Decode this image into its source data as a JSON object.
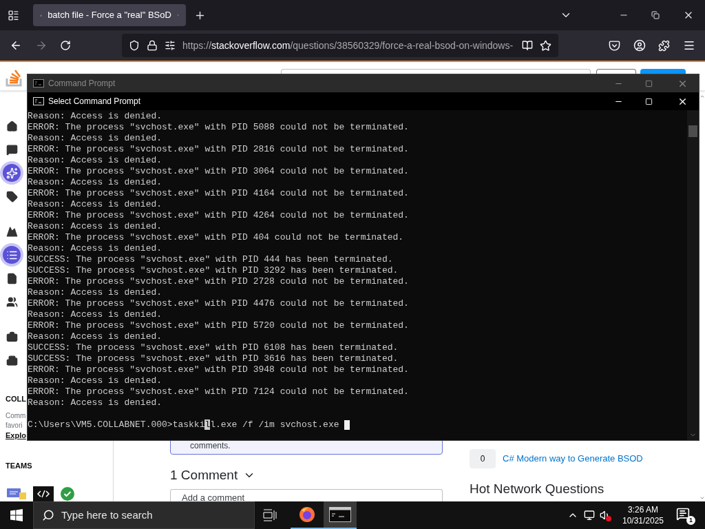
{
  "browser": {
    "tab": {
      "title": "batch file - Force a \"real\" BSoD",
      "selected": true
    },
    "url": {
      "scheme": "https://",
      "host": "stackoverflow.com",
      "path": "/questions/38560329/force-a-real-bsod-on-windows-"
    }
  },
  "page": {
    "sidebar": {
      "sections": [
        [
          {
            "kind": "home",
            "circled": false
          },
          {
            "kind": "question",
            "circled": false
          },
          {
            "kind": "sparkle",
            "circled": true
          },
          {
            "kind": "tag",
            "circled": false
          }
        ],
        [
          {
            "kind": "mountain",
            "circled": false
          },
          {
            "kind": "list",
            "circled": true
          },
          {
            "kind": "document",
            "circled": false
          },
          {
            "kind": "users",
            "circled": false
          }
        ],
        [
          {
            "kind": "briefcase",
            "circled": false
          },
          {
            "kind": "building",
            "circled": false
          }
        ]
      ],
      "collectives": {
        "heading": "COLL",
        "lines": [
          "Comm",
          "favori"
        ],
        "link": "Explo"
      },
      "teams": {
        "heading": "TEAMS"
      }
    },
    "notice_end": "comments.",
    "comments_heading": "1 Comment",
    "comment_placeholder": "Add a comment",
    "related": [
      {
        "score": "0",
        "title": "C# Modern way to Generate BSOD"
      }
    ],
    "hot_heading": "Hot Network Questions"
  },
  "console": {
    "title_bars": [
      {
        "title": "Command Prompt",
        "active": false
      },
      {
        "title": "Select Command Prompt",
        "active": true
      }
    ],
    "lines": [
      "Reason: Access is denied.",
      "ERROR: The process \"svchost.exe\" with PID 5088 could not be terminated.",
      "Reason: Access is denied.",
      "ERROR: The process \"svchost.exe\" with PID 2816 could not be terminated.",
      "Reason: Access is denied.",
      "ERROR: The process \"svchost.exe\" with PID 3064 could not be terminated.",
      "Reason: Access is denied.",
      "ERROR: The process \"svchost.exe\" with PID 4164 could not be terminated.",
      "Reason: Access is denied.",
      "ERROR: The process \"svchost.exe\" with PID 4264 could not be terminated.",
      "Reason: Access is denied.",
      "ERROR: The process \"svchost.exe\" with PID 404 could not be terminated.",
      "Reason: Access is denied.",
      "SUCCESS: The process \"svchost.exe\" with PID 444 has been terminated.",
      "SUCCESS: The process \"svchost.exe\" with PID 3292 has been terminated.",
      "ERROR: The process \"svchost.exe\" with PID 2728 could not be terminated.",
      "Reason: Access is denied.",
      "ERROR: The process \"svchost.exe\" with PID 4476 could not be terminated.",
      "Reason: Access is denied.",
      "ERROR: The process \"svchost.exe\" with PID 5720 could not be terminated.",
      "Reason: Access is denied.",
      "SUCCESS: The process \"svchost.exe\" with PID 6108 has been terminated.",
      "SUCCESS: The process \"svchost.exe\" with PID 3616 has been terminated.",
      "ERROR: The process \"svchost.exe\" with PID 3948 could not be terminated.",
      "Reason: Access is denied.",
      "ERROR: The process \"svchost.exe\" with PID 7124 could not be terminated.",
      "Reason: Access is denied."
    ],
    "prompt": {
      "before": "C:\\Users\\VM5.COLLABNET.000>taskki",
      "selection": "l",
      "after": "l.exe /f /im svchost.exe "
    }
  },
  "taskbar": {
    "search_placeholder": "Type here to search",
    "apps": [
      {
        "kind": "firefox",
        "selected": false
      },
      {
        "kind": "terminal",
        "selected": true
      }
    ],
    "time": "3:26 AM",
    "date": "10/31/2025",
    "notifications": "1"
  }
}
